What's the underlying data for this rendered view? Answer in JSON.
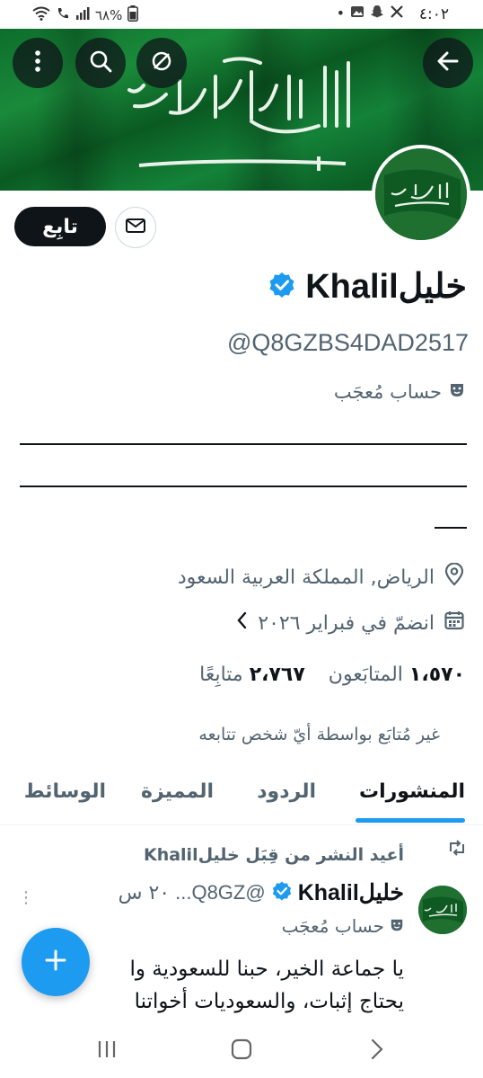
{
  "status_bar": {
    "time": "٤:٠٢",
    "battery": "٦٨%",
    "notification_icons": [
      "x-icon",
      "snapchat-icon",
      "gallery-icon",
      "dot-icon"
    ]
  },
  "header": {
    "back_icon": "arrow-left-icon",
    "mute_icon": "mute-icon",
    "search_icon": "search-icon",
    "more_icon": "more-vertical-icon"
  },
  "profile": {
    "follow_label": "تابِع",
    "name": "خليلKhalil",
    "handle": "@Q8GZBS4DAD2517",
    "parody_label": "حساب مُعجَب",
    "location": "الرياض, المملكة العربية السعود",
    "joined": "انضمّ في فبراير ٢٠٢٦",
    "following_count": "٢،٧٦٧",
    "following_label": "متابِعًا",
    "followers_count": "١،٥٧٠",
    "followers_label": "المتابَعون",
    "not_followed_note": "غير مُتابَع بواسطة أيّ شخص تتابعه",
    "verified_color": "#1d9bf0"
  },
  "tabs": [
    {
      "label": "المنشورات",
      "active": true
    },
    {
      "label": "الردود",
      "active": false
    },
    {
      "label": "المميزة",
      "active": false
    },
    {
      "label": "الوسائط",
      "active": false
    }
  ],
  "tweet": {
    "reposted_by": "أعيد النشر من قِبَل خليلKhalil",
    "name": "خليلKhalil",
    "handle": "@Q8GZ...",
    "time": "٢٠ س",
    "parody_label": "حساب مُعجَب",
    "text_line1": "يا جماعة الخير، حبنا للسعودية وا",
    "text_line2": "يحتاج إثبات، والسعوديات أخواتنا"
  },
  "accent_color": "#1d9bf0"
}
